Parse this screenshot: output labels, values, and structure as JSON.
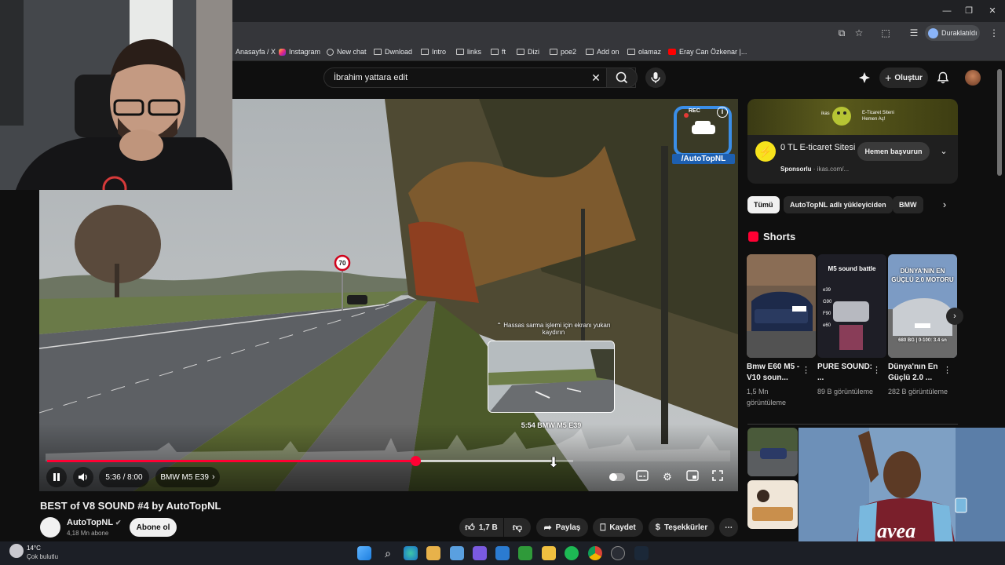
{
  "bookmarks": [
    "Anasayfa / X",
    "Instagram",
    "New chat",
    "Dwnload",
    "Intro",
    "links",
    "ft",
    "Dizi",
    "poe2",
    "Add on",
    "olamaz",
    "Eray Can Özkenar |..."
  ],
  "browser": {
    "profile_label": "Duraklatıldı"
  },
  "header": {
    "search_query": "İbrahim yattara edit",
    "create_label": "Oluştur"
  },
  "player": {
    "time": "5:36 / 8:00",
    "chapter": "BMW M5 E39",
    "played_fraction": 0.7,
    "seek_hint": "Hassas sarma işlemi için ekranı yukarı kaydırın",
    "preview_label": "5:54  BMW M5 E39",
    "watermark_text": "/AutoTopNL",
    "rec_label": "REC"
  },
  "video": {
    "title": "BEST of V8 SOUND #4 by AutoTopNL",
    "channel": "AutoTopNL",
    "subscribers": "4,18 Mn abone",
    "subscribe_label": "Abone ol",
    "likes": "1,7 B",
    "share_label": "Paylaş",
    "save_label": "Kaydet",
    "thanks_label": "Teşekkürler"
  },
  "ad": {
    "banner_text_1": "ikas",
    "banner_text_2": "E-Ticaret Siteni",
    "banner_text_3": "Hemen Aç!",
    "title": "0 TL E-ticaret Sitesi",
    "sponsor_label": "Sponsorlu",
    "sponsor_domain": "ikas.com/...",
    "cta_label": "Hemen başvurun"
  },
  "chips": [
    "Tümü",
    "AutoTopNL adlı yükleyiciden",
    "BMW"
  ],
  "shorts": {
    "section_title": "Shorts",
    "items": [
      {
        "title": "Bmw E60 M5 - V10 soun...",
        "views": "1,5 Mn görüntüleme",
        "overlay": ""
      },
      {
        "title": "PURE SOUND: ...",
        "views": "89 B görüntüleme",
        "overlay": "M5 sound battle"
      },
      {
        "title": "Dünya'nın En Güçlü 2.0 ...",
        "views": "282 B görüntüleme",
        "overlay": "DÜNYA'NIN EN GÜÇLÜ 2.0 MOTORU"
      }
    ],
    "short2_labels": [
      "e39",
      "G90",
      "F90",
      "e60"
    ],
    "short3_caption": "680 BG | 0-100: 3.4 sn"
  },
  "taskbar": {
    "temp": "14°C",
    "weather": "Çok bulutlu"
  },
  "colors": {
    "accent": "#ff0033",
    "bg": "#0f0f0f",
    "chip": "#272727"
  }
}
